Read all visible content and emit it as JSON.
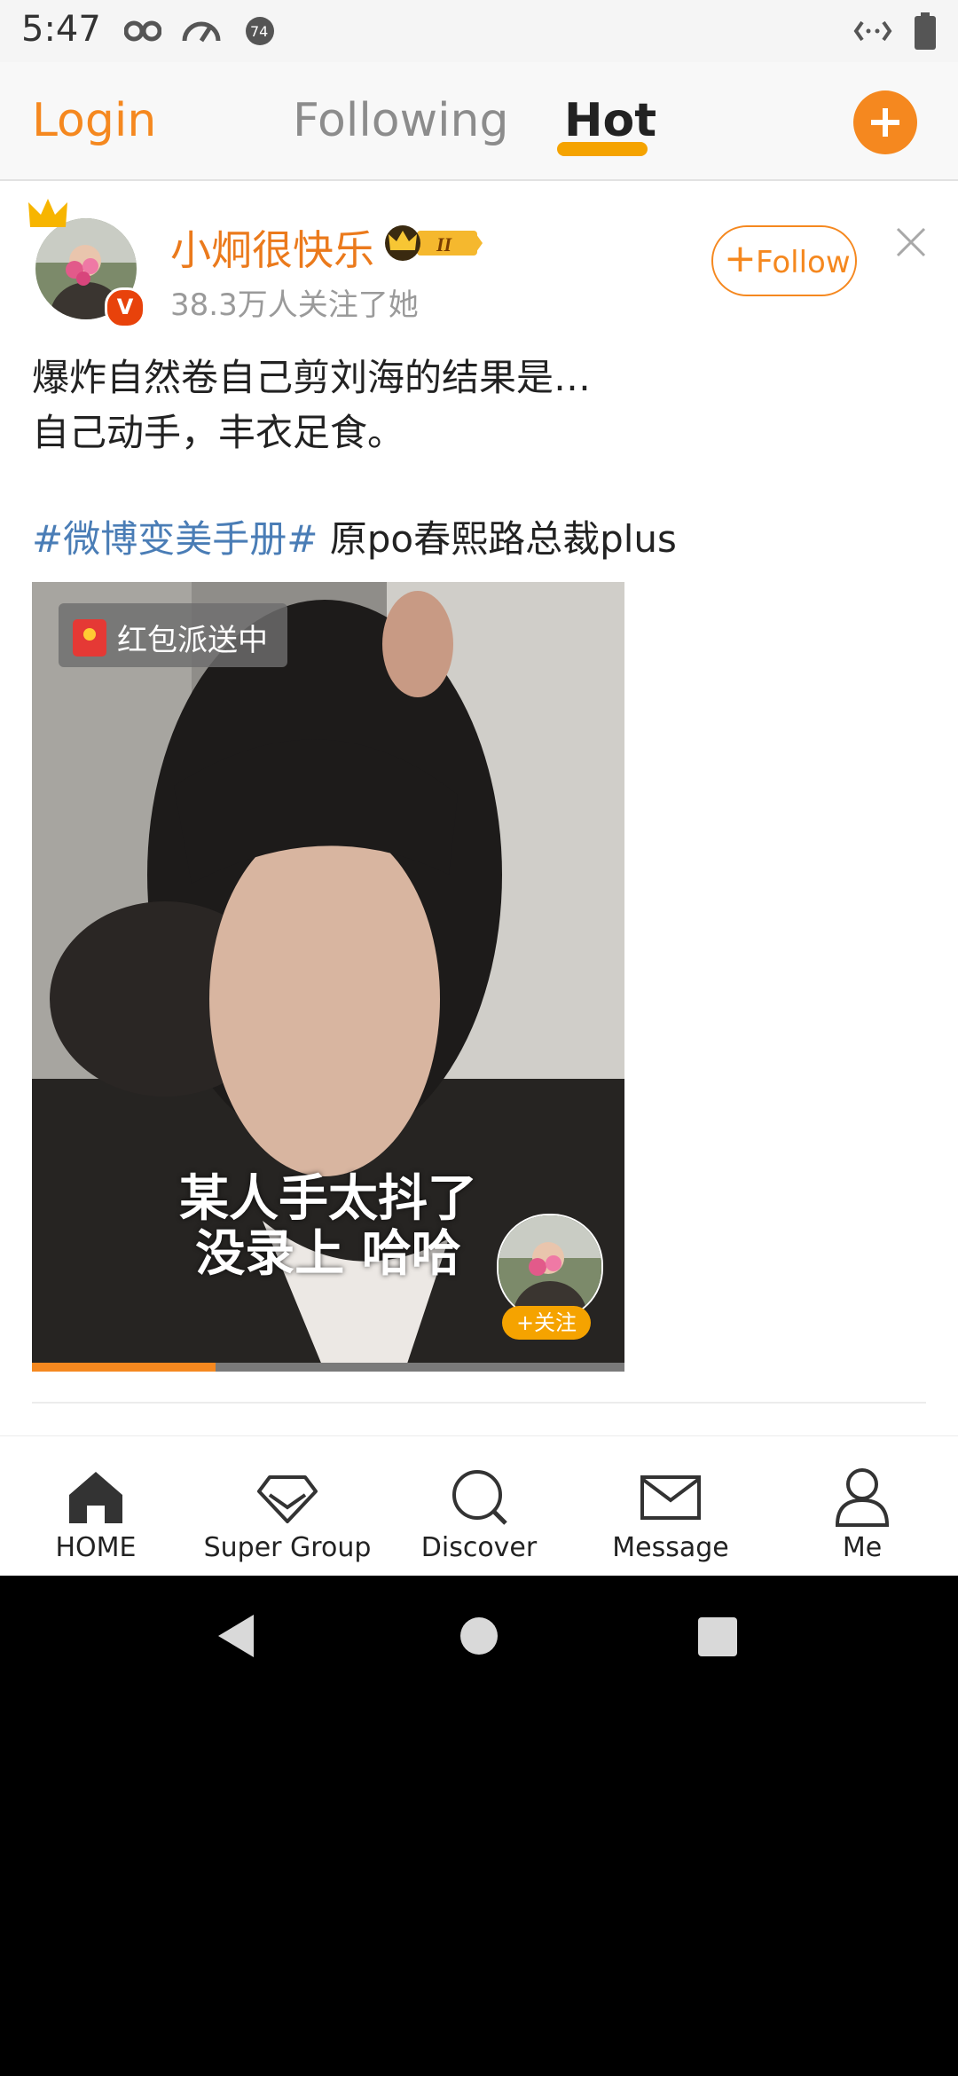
{
  "status_bar": {
    "time": "5:47",
    "icons": [
      "incognito-icon",
      "speedometer-icon",
      "notification-count-icon",
      "data-arrows-icon",
      "battery-icon"
    ],
    "notification_count": "74"
  },
  "top_nav": {
    "login": "Login",
    "tabs": [
      {
        "label": "Following",
        "active": false
      },
      {
        "label": "Hot",
        "active": true
      }
    ],
    "accent": "#f5881f"
  },
  "post": {
    "username": "小炯很快乐",
    "followers": "38.3万人关注了她",
    "follow_label": "Follow",
    "text_line1": "爆炸自然卷自己剪刘海的结果是…",
    "text_line2": "自己动手，丰衣足食。",
    "hashtag": "#微博变美手册#",
    "text_line3_rest": " 原po春熙路总裁plus",
    "media": {
      "red_packet_label": "红包派送中",
      "caption_line1": "某人手太抖了",
      "caption_line2": "没录上 哈哈",
      "mini_follow": "+关注",
      "progress": 0.31
    }
  },
  "bottom_nav": [
    {
      "label": "HOME",
      "icon": "home-icon",
      "active": true
    },
    {
      "label": "Super Group",
      "icon": "diamond-icon",
      "active": false
    },
    {
      "label": "Discover",
      "icon": "search-icon",
      "active": false
    },
    {
      "label": "Message",
      "icon": "mail-icon",
      "active": false
    },
    {
      "label": "Me",
      "icon": "person-icon",
      "active": false
    }
  ],
  "system_nav": [
    "back-icon",
    "home-circle-icon",
    "recents-icon"
  ]
}
